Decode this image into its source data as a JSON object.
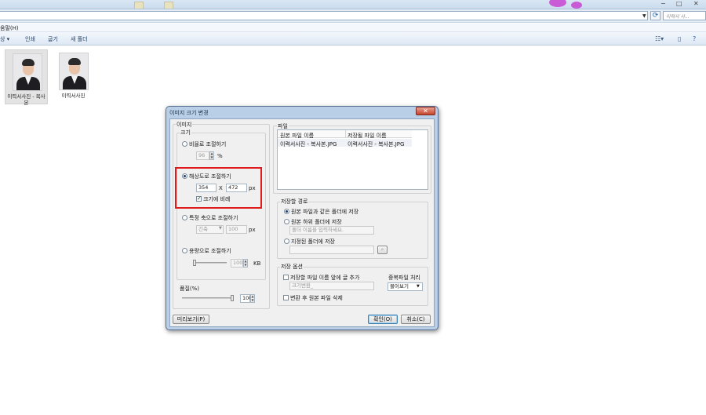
{
  "explorer": {
    "search_placeholder": "이력서 사...",
    "menu_label": "움말(H)",
    "toolbar": {
      "share_label": "상",
      "print_label": "인쇄",
      "burn_label": "굽기",
      "new_folder_label": "새 폴더"
    },
    "files": [
      {
        "name": "이력서사진 - 복사본"
      },
      {
        "name": "이력서사진"
      }
    ],
    "window_controls": {
      "minimize": "−",
      "maximize": "□",
      "close": "✕"
    }
  },
  "dialog": {
    "title": "이미지 크기 변경",
    "close_glyph": "✕",
    "image_group": {
      "title": "이미지",
      "size_subgroup": "크기",
      "ratio_option": "비율로 조절하기",
      "ratio_value": "96",
      "ratio_unit": "%",
      "resolution_option": "해상도로 조절하기",
      "width_value": "354",
      "times": "X",
      "height_value": "472",
      "px_unit": "px",
      "keep_ratio_label": "크기에 비례",
      "keep_ratio_checked": true,
      "axis_option": "특정 축으로 조절하기",
      "axis_select": "긴축",
      "axis_value": "100",
      "capacity_option": "용량으로 조절하기",
      "capacity_value": "100",
      "capacity_unit": "KB",
      "quality_label": "품질(%)",
      "quality_value": "100"
    },
    "file_group": {
      "title": "파일",
      "col_original": "원본 파일 이름",
      "col_save": "저장될 파일 이름",
      "rows": [
        {
          "original": "이력서사진 - 복사본.JPG",
          "save": "이력서사진 - 복사본.JPG"
        }
      ]
    },
    "save_path": {
      "title": "저장할 경로",
      "same_folder": "원본 파일과 같은 폴더에 저장",
      "sub_folder": "원본 하위 폴더에 저장",
      "sub_folder_placeholder": "폴더 이름을 입력하세요.",
      "custom_folder": "지정된 폴더에 저장"
    },
    "save_options": {
      "title": "저장 옵션",
      "prefix_label": "저장할 파일 이름 앞에 글 추가",
      "prefix_value": "크기변환_",
      "delete_label": "변환 후 원본 파일 삭제",
      "duplicate_title": "중복파일 처리",
      "duplicate_value": "물어보기"
    },
    "buttons": {
      "preview": "미리보기(P)",
      "ok": "확인(O)",
      "cancel": "취소(C)"
    }
  }
}
